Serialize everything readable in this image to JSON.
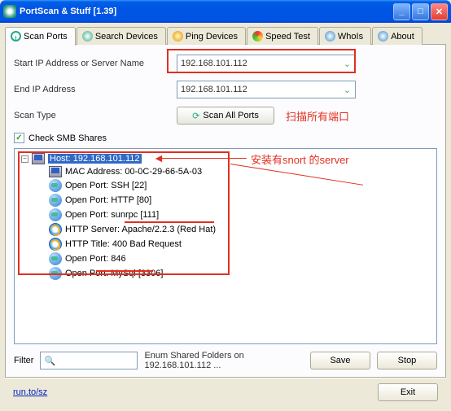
{
  "window": {
    "title": "PortScan & Stuff [1.39]"
  },
  "tabs": [
    {
      "label": "Scan Ports"
    },
    {
      "label": "Search Devices"
    },
    {
      "label": "Ping Devices"
    },
    {
      "label": "Speed Test"
    },
    {
      "label": "WhoIs"
    },
    {
      "label": "About"
    }
  ],
  "form": {
    "start_ip_label": "Start IP Address or Server Name",
    "start_ip_value": "192.168.101.112",
    "end_ip_label": "End IP Address",
    "end_ip_value": "192.168.101.112",
    "scan_type_label": "Scan Type",
    "scan_all_label": "Scan All Ports",
    "scan_all_annotation": "扫描所有端口",
    "check_smb_label": "Check SMB Shares"
  },
  "tree": {
    "host_label": "Host: 192.168.101.112",
    "nodes": [
      {
        "icon": "pc",
        "text": "MAC Address: 00-0C-29-66-5A-03"
      },
      {
        "icon": "world",
        "text": "Open Port: SSH [22]"
      },
      {
        "icon": "world",
        "text": "Open Port: HTTP [80]"
      },
      {
        "icon": "world",
        "text": "Open Port: sunrpc [111]"
      },
      {
        "icon": "ie",
        "text": "HTTP Server: Apache/2.2.3 (Red Hat)"
      },
      {
        "icon": "ie",
        "text": "HTTP Title: 400 Bad Request"
      },
      {
        "icon": "world",
        "text": "Open Port: 846"
      },
      {
        "icon": "world",
        "text": "Open Port: MySql [3306]"
      }
    ],
    "annotation": "安装有snort 的server"
  },
  "bottom": {
    "filter_label": "Filter",
    "status_text": "Enum Shared Folders on 192.168.101.112 ...",
    "save_label": "Save",
    "stop_label": "Stop"
  },
  "footer": {
    "link": "run.to/sz",
    "exit_label": "Exit"
  }
}
